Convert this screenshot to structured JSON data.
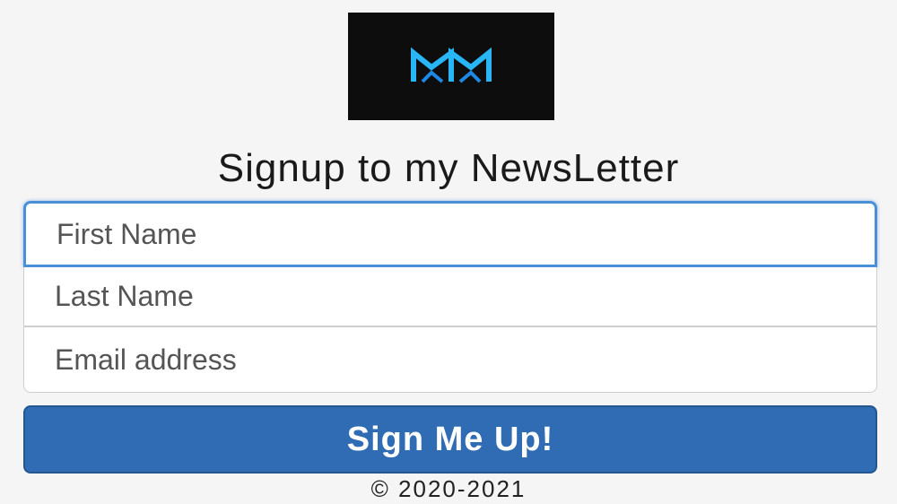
{
  "logo": {
    "icon": "mm-logo-icon",
    "background": "#0d0d0d",
    "accent": "#29b6f6"
  },
  "title": "Signup to my NewsLetter",
  "form": {
    "first_name_placeholder": "First Name",
    "last_name_placeholder": "Last Name",
    "email_placeholder": "Email address",
    "submit_label": "Sign Me Up!"
  },
  "footer": {
    "copyright": "© 2020-2021"
  },
  "colors": {
    "button": "#2f6cb3",
    "focus_ring": "#4a90d9"
  }
}
